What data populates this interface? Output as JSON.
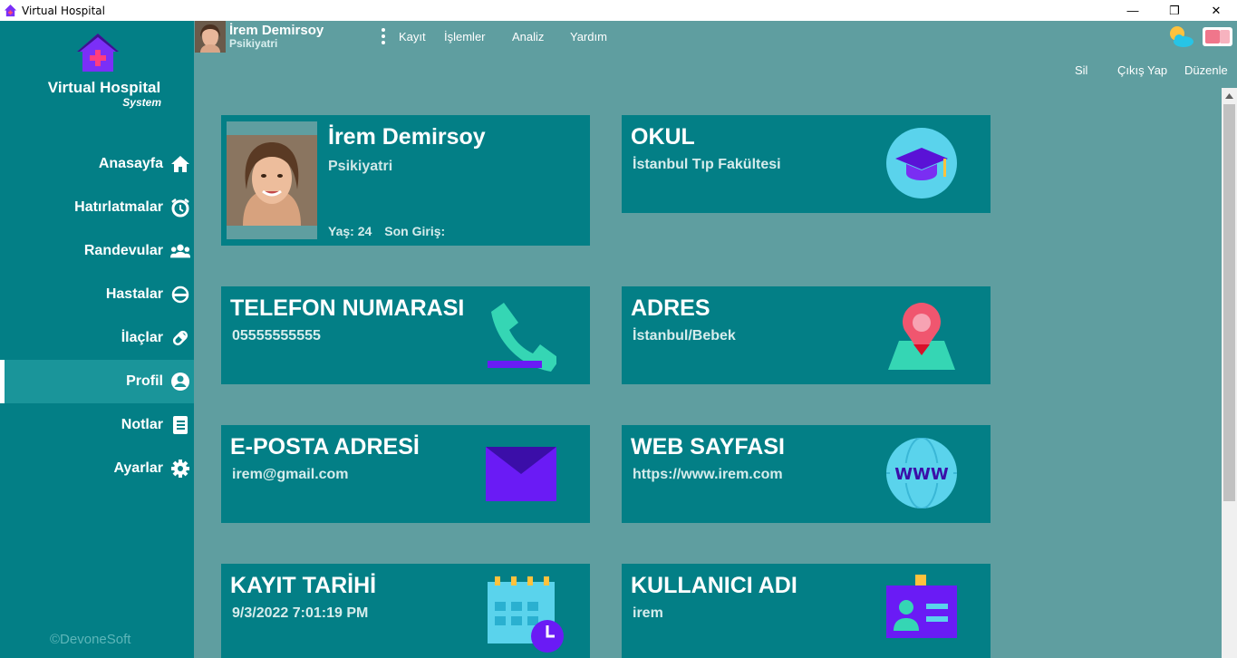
{
  "window": {
    "title": "Virtual Hospital",
    "controls": {
      "minimize": "—",
      "restore": "❐",
      "close": "✕"
    }
  },
  "sidebar": {
    "brand_name": "Virtual Hospital",
    "brand_sub": "System",
    "items": [
      {
        "label": "Anasayfa",
        "icon": "home-icon"
      },
      {
        "label": "Hatırlatmalar",
        "icon": "alarm-clock-icon"
      },
      {
        "label": "Randevular",
        "icon": "users-icon"
      },
      {
        "label": "Hastalar",
        "icon": "patient-icon"
      },
      {
        "label": "İlaçlar",
        "icon": "pill-icon"
      },
      {
        "label": "Profil",
        "icon": "user-circle-icon",
        "active": true
      },
      {
        "label": "Notlar",
        "icon": "notebook-icon"
      },
      {
        "label": "Ayarlar",
        "icon": "gear-icon"
      }
    ],
    "copyright": "©DevoneSoft"
  },
  "header": {
    "user_name": "İrem Demirsoy",
    "user_role": "Psikiyatri",
    "menu": [
      "Kayıt",
      "İşlemler",
      "Analiz",
      "Yardım"
    ],
    "actions": [
      "Sil",
      "Çıkış Yap",
      "Düzenle"
    ]
  },
  "profile": {
    "name": "İrem Demirsoy",
    "role": "Psikiyatri",
    "age_text": "Yaş: 24",
    "last_login_text": "Son Giriş:"
  },
  "cards": {
    "school": {
      "title": "OKUL",
      "value": "İstanbul Tıp Fakültesi",
      "icon": "graduation-cap-icon"
    },
    "phone": {
      "title": "TELEFON NUMARASI",
      "value": "05555555555",
      "icon": "phone-icon"
    },
    "address": {
      "title": "ADRES",
      "value": "İstanbul/Bebek",
      "icon": "map-pin-icon"
    },
    "email": {
      "title": "E-POSTA ADRESİ",
      "value": "irem@gmail.com",
      "icon": "envelope-icon"
    },
    "web": {
      "title": "WEB SAYFASI",
      "value": "https://www.irem.com",
      "icon": "www-globe-icon"
    },
    "reg_date": {
      "title": "KAYIT TARİHİ",
      "value": "9/3/2022 7:01:19 PM",
      "icon": "calendar-clock-icon"
    },
    "username": {
      "title": "KULLANICI ADI",
      "value": "irem",
      "icon": "id-card-icon"
    }
  },
  "colors": {
    "sidebar": "#037f86",
    "content_bg": "#5f9ea0",
    "card": "#037f86",
    "accent_purple": "#6a1bf5",
    "accent_teal": "#35d6b4"
  }
}
